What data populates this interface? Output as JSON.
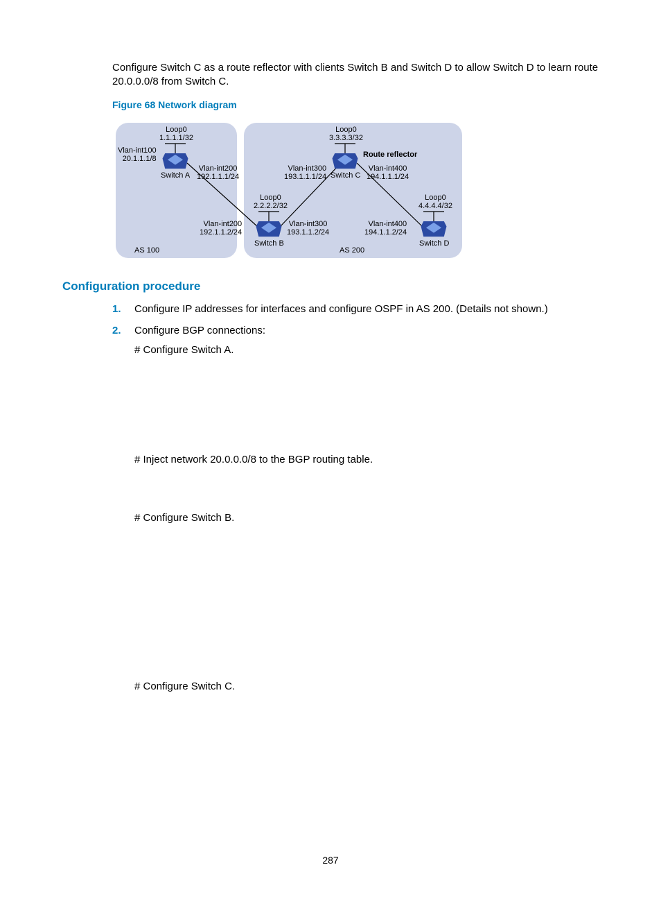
{
  "intro": "Configure Switch C as a route reflector with clients Switch B and Switch D to allow Switch D to learn route 20.0.0.0/8 from Switch C.",
  "figure_caption": "Figure 68 Network diagram",
  "diagram": {
    "as100_label": "AS 100",
    "as200_label": "AS 200",
    "route_reflector": "Route reflector",
    "switchA": {
      "name": "Switch A",
      "loop": "Loop0\n1.1.1.1/32",
      "vlan_left": "Vlan-int100\n20.1.1.1/8",
      "vlan_right": "Vlan-int200\n192.1.1.1/24"
    },
    "switchB": {
      "name": "Switch B",
      "loop": "Loop0\n2.2.2.2/32",
      "vlan_left": "Vlan-int200\n192.1.1.2/24",
      "vlan_right": "Vlan-int300\n193.1.1.2/24"
    },
    "switchC": {
      "name": "Switch C",
      "loop": "Loop0\n3.3.3.3/32",
      "vlan_left": "Vlan-int300\n193.1.1.1/24",
      "vlan_right": "Vlan-int400\n194.1.1.1/24"
    },
    "switchD": {
      "name": "Switch D",
      "loop": "Loop0\n4.4.4.4/32",
      "vlan_left": "Vlan-int400\n194.1.1.2/24"
    }
  },
  "section_heading": "Configuration procedure",
  "steps": {
    "s1": "Configure IP addresses for interfaces and configure OSPF in AS 200. (Details not shown.)",
    "s2": "Configure BGP connections:",
    "s2a": "# Configure Switch A.",
    "s2b": "# Inject network 20.0.0.0/8 to the BGP routing table.",
    "s2c": "# Configure Switch B.",
    "s2d": "# Configure Switch C."
  },
  "page_number": "287"
}
